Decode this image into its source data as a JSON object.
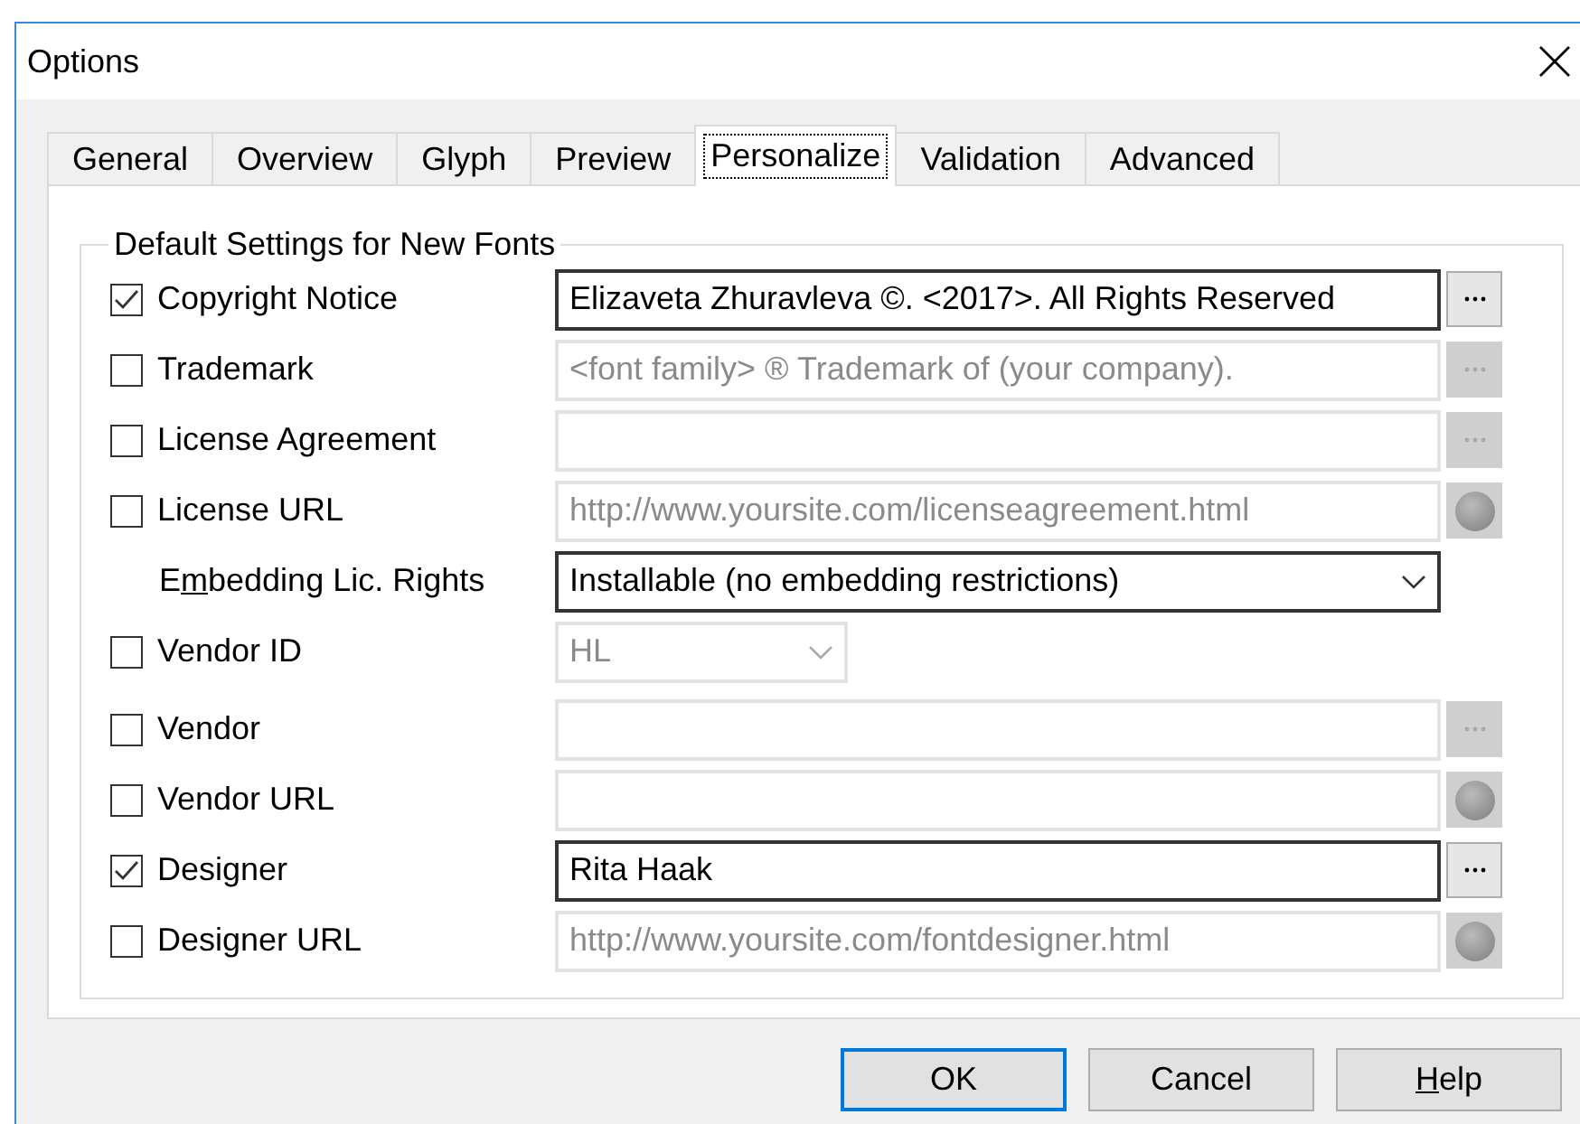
{
  "window": {
    "title": "Options"
  },
  "tabs": [
    {
      "label": "General",
      "selected": false
    },
    {
      "label": "Overview",
      "selected": false
    },
    {
      "label": "Glyph",
      "selected": false
    },
    {
      "label": "Preview",
      "selected": false
    },
    {
      "label": "Personalize",
      "selected": true
    },
    {
      "label": "Validation",
      "selected": false
    },
    {
      "label": "Advanced",
      "selected": false
    }
  ],
  "group": {
    "title": "Default Settings for New Fonts"
  },
  "rows": [
    {
      "kind": "text",
      "label": "Copyright Notice",
      "checked": true,
      "field": {
        "value": "Elizaveta Zhuravleva ©. <2017>. All Rights Reserved",
        "disabled": false
      },
      "button": {
        "kind": "ellipsis",
        "disabled": false
      }
    },
    {
      "kind": "text",
      "label": "Trademark",
      "checked": false,
      "field": {
        "value": "<font family> ® Trademark of (your company).",
        "disabled": true
      },
      "button": {
        "kind": "ellipsis",
        "disabled": true
      }
    },
    {
      "kind": "text",
      "label": "License Agreement",
      "checked": false,
      "field": {
        "disabled": true
      },
      "button": {
        "kind": "ellipsis",
        "disabled": true
      }
    },
    {
      "kind": "text",
      "label": "License URL",
      "checked": false,
      "field": {
        "value": "http://www.yoursite.com/licenseagreement.html",
        "disabled": true
      },
      "button": {
        "kind": "globe",
        "disabled": true
      }
    },
    {
      "kind": "combo",
      "label": {
        "before": "E",
        "mnemonic": "m",
        "after": "bedding Lic. Rights"
      },
      "field": {
        "value": "Installable (no embedding restrictions)",
        "disabled": false
      }
    },
    {
      "kind": "smallcombo",
      "label": "Vendor ID",
      "checked": false,
      "field": {
        "value": "HL",
        "disabled": true
      }
    },
    {
      "kind": "text",
      "label": "Vendor",
      "checked": false,
      "field": {
        "disabled": true
      },
      "button": {
        "kind": "ellipsis",
        "disabled": true
      }
    },
    {
      "kind": "text",
      "label": "Vendor URL",
      "checked": false,
      "field": {
        "disabled": true
      },
      "button": {
        "kind": "globe",
        "disabled": true
      }
    },
    {
      "kind": "text",
      "label": "Designer",
      "checked": true,
      "field": {
        "value": "Rita Haak",
        "disabled": false
      },
      "button": {
        "kind": "ellipsis",
        "disabled": false
      }
    },
    {
      "kind": "text",
      "label": "Designer URL",
      "checked": false,
      "field": {
        "value": "http://www.yoursite.com/fontdesigner.html",
        "disabled": true
      },
      "button": {
        "kind": "globe",
        "disabled": true
      }
    }
  ],
  "buttons": [
    {
      "label": "OK",
      "default": true
    },
    {
      "label": "Cancel",
      "default": false
    },
    {
      "label": {
        "mnemonic": "H",
        "after": "elp"
      },
      "default": false
    }
  ]
}
